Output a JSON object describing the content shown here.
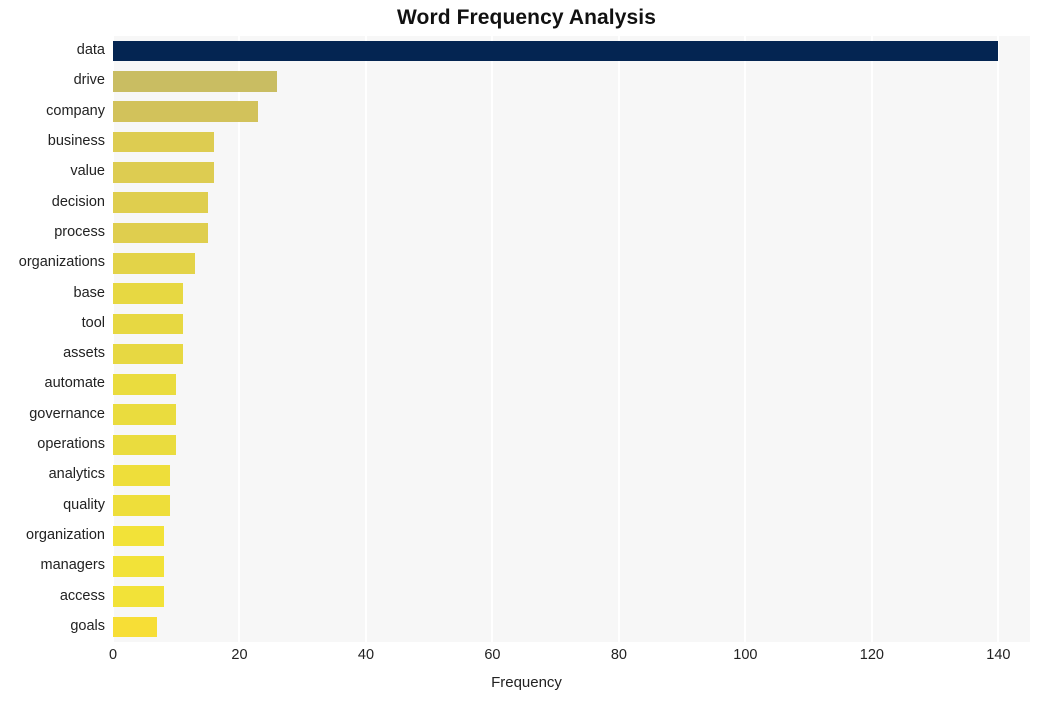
{
  "chart_data": {
    "type": "bar",
    "orientation": "horizontal",
    "title": "Word Frequency Analysis",
    "xlabel": "Frequency",
    "ylabel": "",
    "categories": [
      "data",
      "drive",
      "company",
      "business",
      "value",
      "decision",
      "process",
      "organizations",
      "base",
      "tool",
      "assets",
      "automate",
      "governance",
      "operations",
      "analytics",
      "quality",
      "organization",
      "managers",
      "access",
      "goals"
    ],
    "values": [
      140,
      26,
      23,
      16,
      16,
      15,
      15,
      13,
      11,
      11,
      11,
      10,
      10,
      10,
      9,
      9,
      8,
      8,
      8,
      7
    ],
    "bar_colors": [
      "#042552",
      "#c9bd62",
      "#d2c25b",
      "#ddcc51",
      "#ddcc51",
      "#dfce4e",
      "#dfce4e",
      "#e3d348",
      "#e7d842",
      "#e7d842",
      "#e7d842",
      "#eadc3e",
      "#eadc3e",
      "#eadc3e",
      "#eede3a",
      "#eede3a",
      "#f2e238",
      "#f2e238",
      "#f2e238",
      "#f7de36"
    ],
    "xlim": [
      0,
      145
    ],
    "xticks": [
      0,
      20,
      40,
      60,
      80,
      100,
      120,
      140
    ],
    "xtick_labels": [
      "0",
      "20",
      "40",
      "60",
      "80",
      "100",
      "120",
      "140"
    ],
    "grid": true,
    "grid_axis": "x",
    "legend": "none",
    "plot_background": "#f7f7f7",
    "figure_background": "#ffffff",
    "gridline_color": "#ffffff"
  }
}
